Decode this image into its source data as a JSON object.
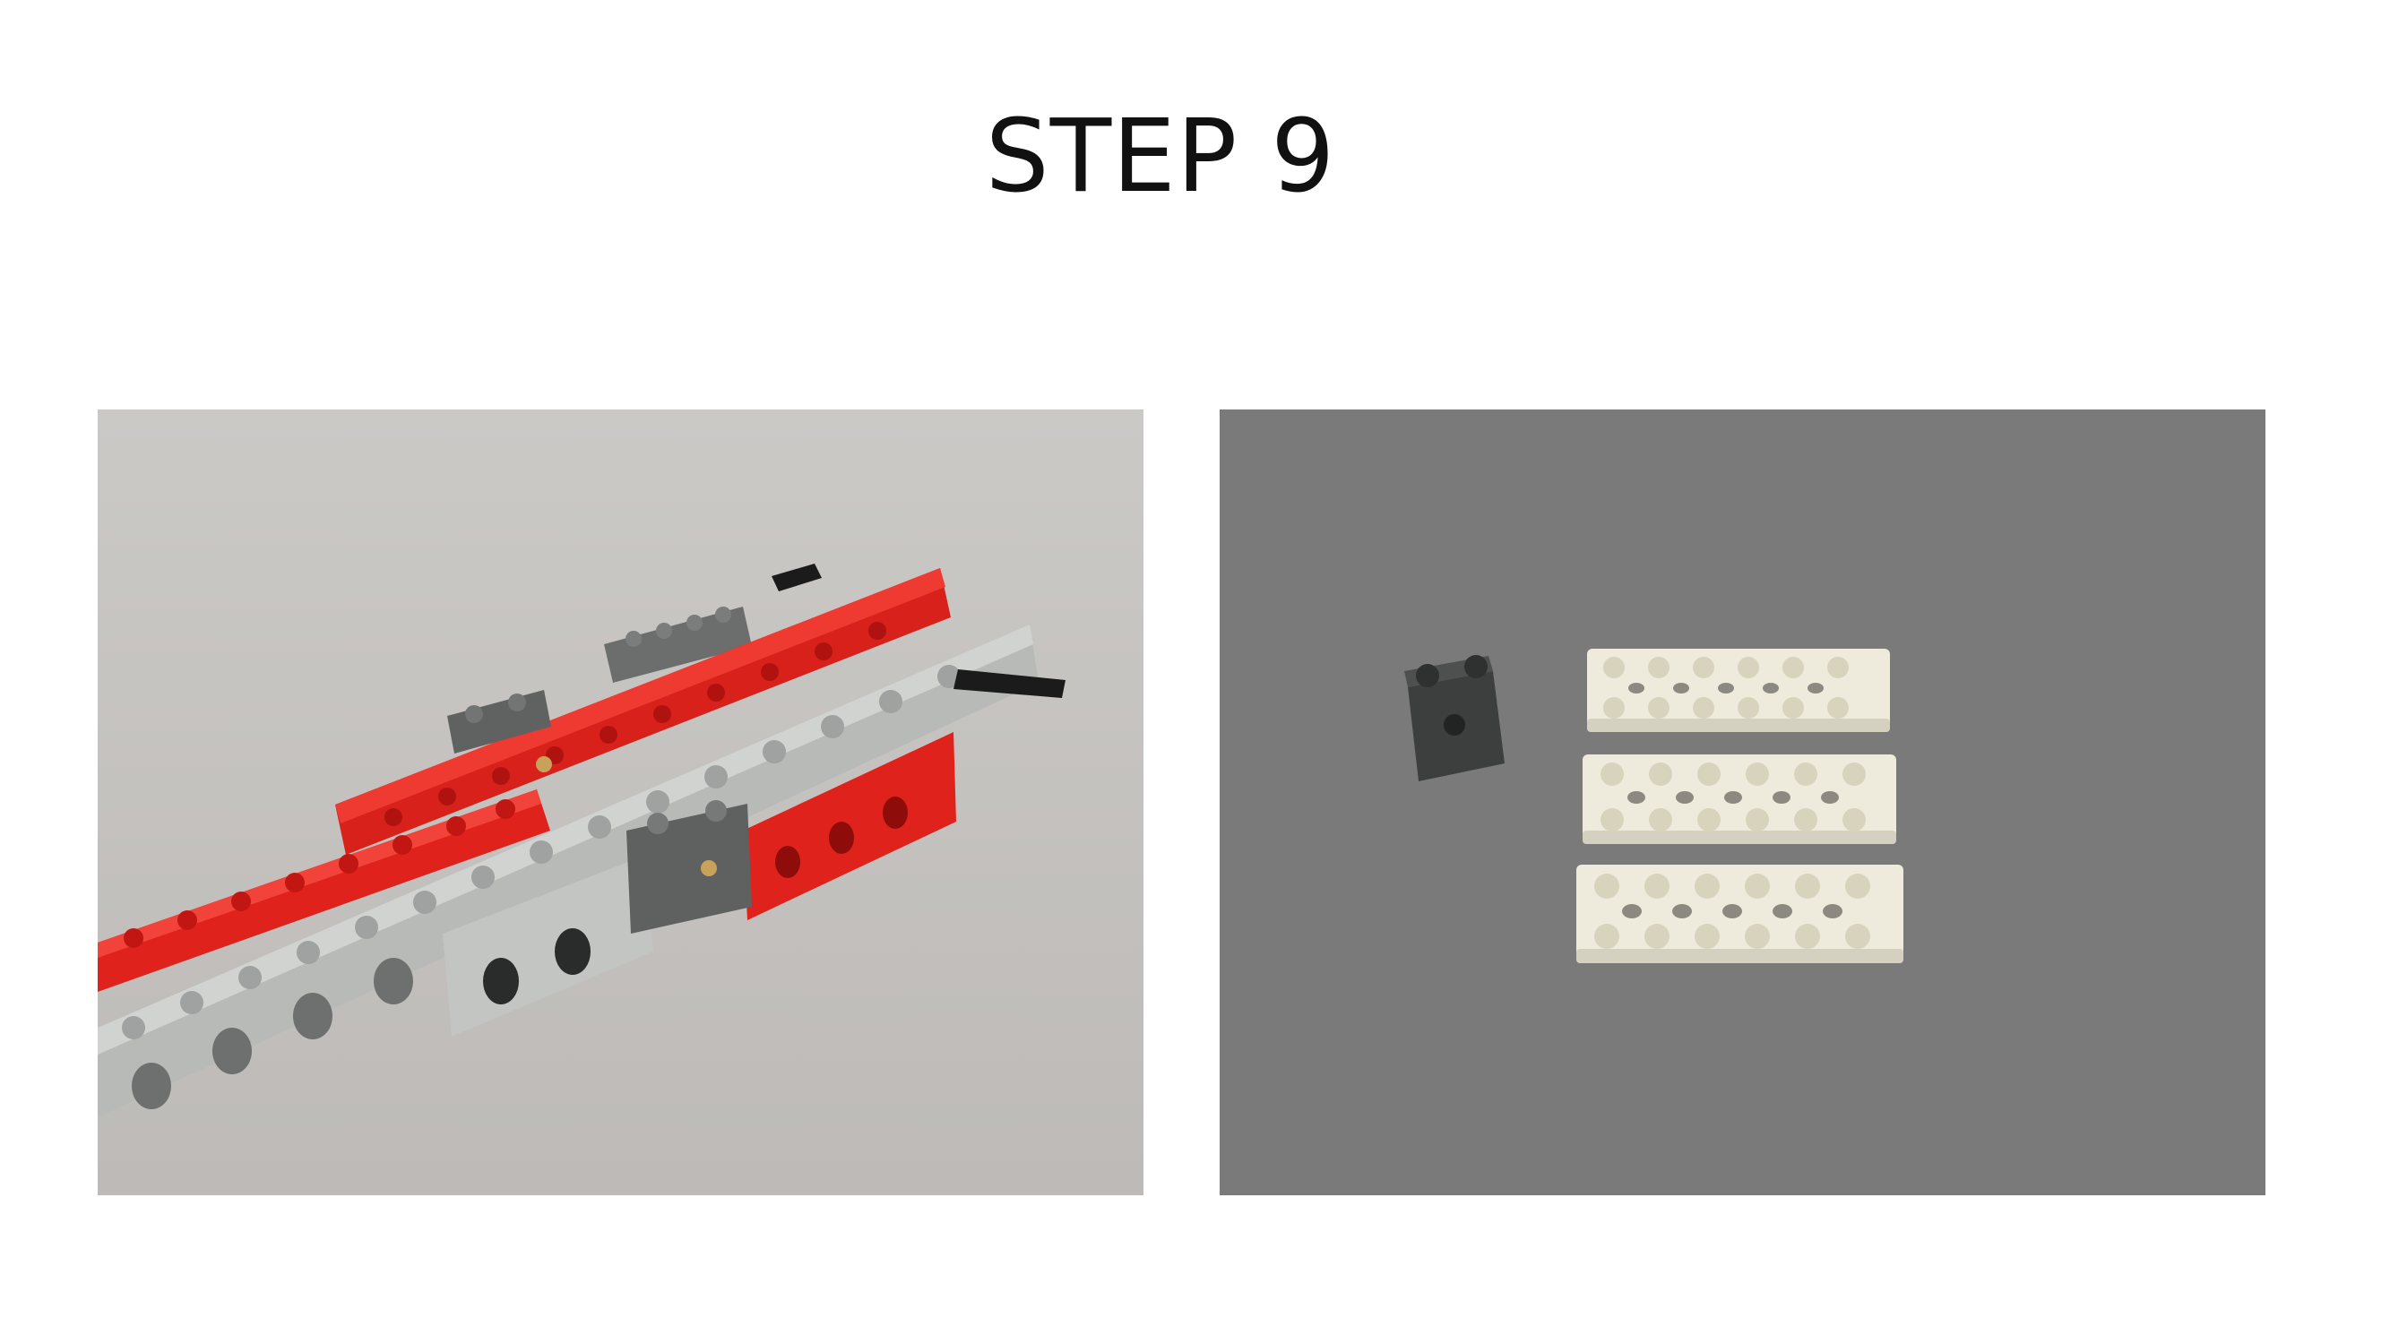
{
  "slide": {
    "title": "STEP 9"
  },
  "images": {
    "left": {
      "subject": "partial-lego-technic-assembly",
      "colors": {
        "background": "#cbc9c6",
        "red": "#e0201a",
        "light_gray": "#b9bcb9",
        "dark_gray": "#5e6160",
        "axle": "#1b1b1b",
        "pin": "#c8a15a"
      }
    },
    "right": {
      "subject": "parts-for-step",
      "colors": {
        "background": "#7a7a7a",
        "dark_brick": "#3d3f3f",
        "plate": "#eeebdd"
      }
    }
  }
}
